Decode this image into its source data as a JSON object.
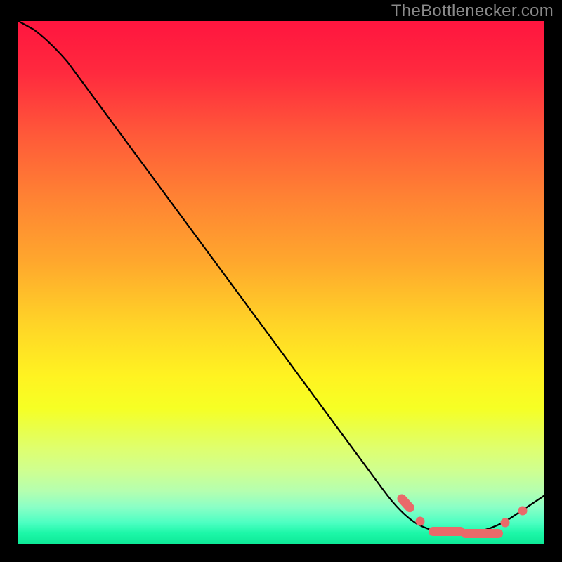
{
  "attribution": "TheBottlenecker.com",
  "chart_data": {
    "type": "line",
    "title": "",
    "xlabel": "",
    "ylabel": "",
    "xlim": [
      0,
      100
    ],
    "ylim": [
      0,
      100
    ],
    "note": "Axes are unlabeled; values below are normalized 0–100 estimates read from the plot geometry (x left→right, y bottom→top).",
    "series": [
      {
        "name": "curve",
        "x": [
          0,
          3,
          8,
          14,
          20,
          28,
          36,
          44,
          52,
          60,
          68,
          73,
          77,
          80,
          83,
          86,
          89,
          92,
          95,
          98,
          100
        ],
        "y": [
          100,
          98.5,
          95,
          90,
          83,
          73,
          62,
          51,
          40,
          29,
          18,
          11,
          6.5,
          4,
          2.7,
          2.2,
          2.2,
          2.7,
          4.2,
          6.7,
          8.5
        ]
      }
    ],
    "markers": {
      "descent_cluster_x_range": [
        73,
        77
      ],
      "trough_cluster_x_range": [
        80,
        92
      ],
      "ascent_marker_x": 96,
      "marker_y_approx": 3
    },
    "background_gradient": {
      "top": "#ff153f",
      "mid": "#ffe522",
      "bottom": "#0ee997"
    }
  }
}
